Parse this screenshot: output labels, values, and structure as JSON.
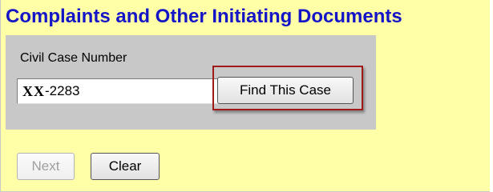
{
  "page": {
    "title": "Complaints and Other Initiating Documents"
  },
  "case_search": {
    "label": "Civil Case Number",
    "value_prefix": "XX",
    "value_suffix": "-2283",
    "find_button_label": "Find This Case"
  },
  "actions": {
    "next_label": "Next",
    "clear_label": "Clear"
  },
  "colors": {
    "background": "#ffffa8",
    "title": "#1515c8",
    "panel": "#c8c8c8",
    "highlight_border": "#a01a1a"
  }
}
